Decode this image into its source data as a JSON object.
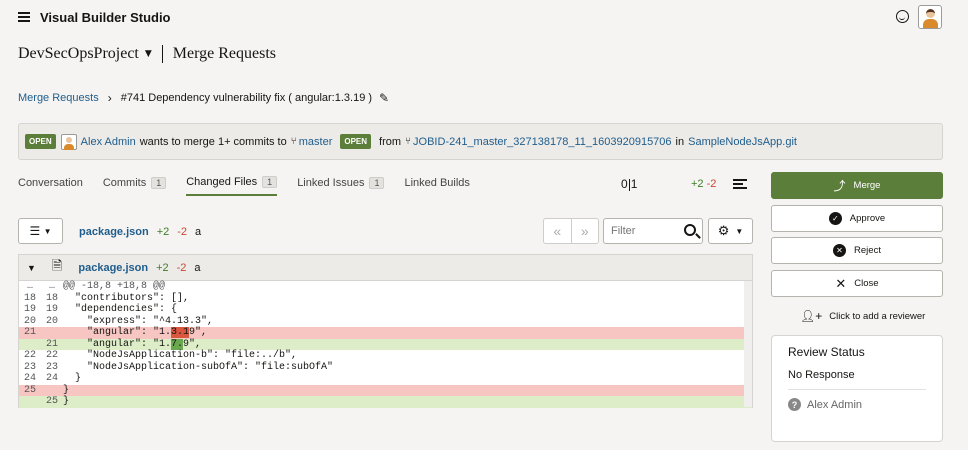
{
  "header": {
    "app_title": "Visual Builder Studio"
  },
  "project": {
    "name": "DevSecOpsProject",
    "section": "Merge Requests"
  },
  "breadcrumb": {
    "parent": "Merge Requests",
    "current": "#741 Dependency vulnerability fix ( angular:1.3.19 )"
  },
  "banner": {
    "status": "OPEN",
    "user": "Alex Admin",
    "text1": "wants to merge 1+ commits to",
    "target_branch": "master",
    "target_status": "OPEN",
    "from_label": "from",
    "source_branch": "JOBID-241_master_327138178_11_1603920915706",
    "in_label": "in",
    "repo": "SampleNodeJsApp.git"
  },
  "tabs": [
    {
      "label": "Conversation",
      "count": ""
    },
    {
      "label": "Commits",
      "count": "1"
    },
    {
      "label": "Changed Files",
      "count": "1"
    },
    {
      "label": "Linked Issues",
      "count": "1"
    },
    {
      "label": "Linked Builds",
      "count": ""
    }
  ],
  "progress": {
    "left": "0",
    "right": "1"
  },
  "diffstat": {
    "plus": "+2",
    "minus": "-2"
  },
  "toolbar": {
    "file": "package.json",
    "plus": "+2",
    "minus": "-2",
    "mode": "a",
    "filter_placeholder": "Filter"
  },
  "diff": {
    "file": "package.json",
    "plus": "+2",
    "minus": "-2",
    "mode": "a",
    "hunk_header": "@@ -18,8 +18,8 @@",
    "lines": [
      {
        "n1": "18",
        "n2": "18",
        "type": "ctx",
        "pre": "  \"contributors\": [],",
        "hl": "",
        "post": ""
      },
      {
        "n1": "19",
        "n2": "19",
        "type": "ctx",
        "pre": "  \"dependencies\": {",
        "hl": "",
        "post": ""
      },
      {
        "n1": "20",
        "n2": "20",
        "type": "ctx",
        "pre": "    \"express\": \"^4.13.3\",",
        "hl": "",
        "post": ""
      },
      {
        "n1": "21",
        "n2": "",
        "type": "del",
        "pre": "    \"angular\": \"1.",
        "hl": "3.1",
        "post": "9\","
      },
      {
        "n1": "",
        "n2": "21",
        "type": "add",
        "pre": "    \"angular\": \"1.",
        "hl": "7.",
        "post": "9\","
      },
      {
        "n1": "22",
        "n2": "22",
        "type": "ctx",
        "pre": "    \"NodeJsApplication-b\": \"file:../b\",",
        "hl": "",
        "post": ""
      },
      {
        "n1": "23",
        "n2": "23",
        "type": "ctx",
        "pre": "    \"NodeJsApplication-subOfA\": \"file:subOfA\"",
        "hl": "",
        "post": ""
      },
      {
        "n1": "24",
        "n2": "24",
        "type": "ctx",
        "pre": "  }",
        "hl": "",
        "post": ""
      },
      {
        "n1": "25",
        "n2": "",
        "type": "del",
        "pre": "}",
        "hl": "",
        "post": ""
      },
      {
        "n1": "",
        "n2": "25",
        "type": "add",
        "pre": "}",
        "hl": "",
        "post": ""
      }
    ]
  },
  "actions": {
    "merge": "Merge",
    "approve": "Approve",
    "reject": "Reject",
    "close": "Close",
    "add_reviewer": "Click to add a reviewer"
  },
  "review": {
    "title": "Review Status",
    "status": "No Response",
    "reviewer": "Alex Admin"
  }
}
